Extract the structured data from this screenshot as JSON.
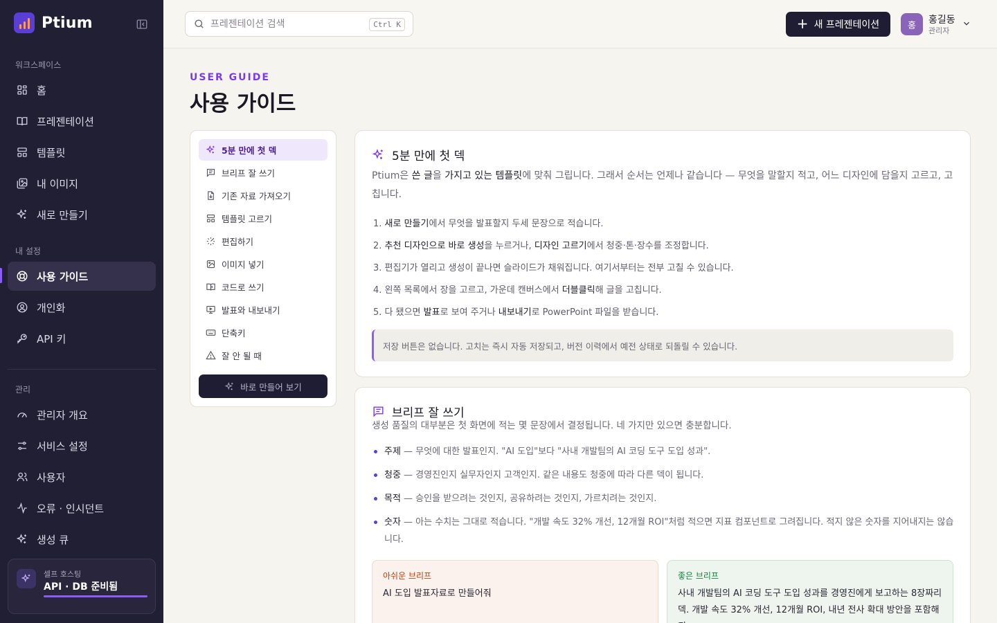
{
  "brand": {
    "name": "Ptium"
  },
  "sidebar": {
    "sections": {
      "workspace": "워크스페이스",
      "settings": "내 설정",
      "admin": "관리"
    },
    "items": [
      {
        "label": "홈",
        "icon": "grid-icon"
      },
      {
        "label": "프레젠테이션",
        "icon": "book-open-icon"
      },
      {
        "label": "템플릿",
        "icon": "layout-icon"
      },
      {
        "label": "내 이미지",
        "icon": "images-icon"
      },
      {
        "label": "새로 만들기",
        "icon": "sparkles-icon"
      },
      {
        "label": "사용 가이드",
        "icon": "lifebuoy-icon",
        "active": true
      },
      {
        "label": "개인화",
        "icon": "user-circle-icon"
      },
      {
        "label": "API 키",
        "icon": "key-icon"
      },
      {
        "label": "관리자 개요",
        "icon": "gauge-icon"
      },
      {
        "label": "서비스 설정",
        "icon": "sliders-icon"
      },
      {
        "label": "사용자",
        "icon": "users-icon"
      },
      {
        "label": "오류 · 인시던트",
        "icon": "activity-icon"
      },
      {
        "label": "생성 큐",
        "icon": "sparkles-icon"
      }
    ],
    "selfhost": {
      "label": "셀프 호스팅",
      "status": "API · DB 준비됨",
      "progress": 1.0
    }
  },
  "header": {
    "search_placeholder": "프레젠테이션 검색",
    "shortcut": "Ctrl K",
    "new_button": "새 프레젠테이션",
    "user": {
      "initial": "홍",
      "name": "홍길동",
      "role": "관리자"
    }
  },
  "page": {
    "eyebrow": "USER GUIDE",
    "title": "사용 가이드"
  },
  "toc": {
    "items": [
      {
        "label": "5분 만에 첫 덱",
        "icon": "sparkles-icon",
        "active": true
      },
      {
        "label": "브리프 잘 쓰기",
        "icon": "message-square-icon"
      },
      {
        "label": "기존 자료 가져오기",
        "icon": "file-import-icon"
      },
      {
        "label": "템플릿 고르기",
        "icon": "layout-icon"
      },
      {
        "label": "편집하기",
        "icon": "wand-icon"
      },
      {
        "label": "이미지 넣기",
        "icon": "image-icon"
      },
      {
        "label": "코드로 쓰기",
        "icon": "book-code-icon"
      },
      {
        "label": "발표와 내보내기",
        "icon": "presentation-icon"
      },
      {
        "label": "단축키",
        "icon": "keyboard-icon"
      },
      {
        "label": "잘 안 될 때",
        "icon": "alert-triangle-icon"
      }
    ],
    "cta": "바로 만들어 보기"
  },
  "quickstart": {
    "title": "5분 만에 첫 덱",
    "intro": {
      "p1": "Ptium은 ",
      "b1": "쓴 글",
      "p2": "을 ",
      "b2": "가지고 있는 템플릿",
      "p3": "에 맞춰 그립니다. 그래서 순서는 언제나 같습니다 — 무엇을 말할지 적고, 어느 디자인에 담을지 고르고, 고칩니다."
    },
    "steps": [
      {
        "n": "1.",
        "b1": "새로 만들기",
        "t1": "에서 무엇을 발표할지 두세 문장으로 적습니다.",
        "b2": "",
        "t2": "",
        "b3": "",
        "t3": ""
      },
      {
        "n": "2.",
        "b1": "추천 디자인으로 바로 생성",
        "t1": "을 누르거나, ",
        "b2": "디자인 고르기",
        "t2": "에서 청중·톤·장수를 조정합니다.",
        "b3": "",
        "t3": ""
      },
      {
        "n": "3.",
        "b1": "",
        "t1": "편집기가 열리고 생성이 끝나면 슬라이드가 채워집니다. 여기서부터는 전부 고칠 수 있습니다.",
        "b2": "",
        "t2": "",
        "b3": "",
        "t3": ""
      },
      {
        "n": "4.",
        "b1": "",
        "t1": "왼쪽 목록에서 장을 고르고, 가운데 캔버스에서 ",
        "b2": "더블클릭",
        "t2": "해 글을 고칩니다.",
        "b3": "",
        "t3": ""
      },
      {
        "n": "5.",
        "b1": "",
        "t1": "다 됐으면 ",
        "b2": "발표",
        "t2": "로 보여 주거나 ",
        "b3": "내보내기",
        "t3": "로 PowerPoint 파일을 받습니다."
      }
    ],
    "note": "저장 버튼은 없습니다. 고치는 즉시 자동 저장되고, 버전 이력에서 예전 상태로 되돌릴 수 있습니다."
  },
  "brief": {
    "title": "브리프 잘 쓰기",
    "intro": "생성 품질의 대부분은 첫 화면에 적는 몇 문장에서 결정됩니다. 네 가지만 있으면 충분합니다.",
    "bullets": [
      {
        "term": "주제",
        "text": " — 무엇에 대한 발표인지. \"AI 도입\"보다 \"사내 개발팀의 AI 코딩 도구 도입 성과\"."
      },
      {
        "term": "청중",
        "text": " — 경영진인지 실무자인지 고객인지. 같은 내용도 청중에 따라 다른 덱이 됩니다."
      },
      {
        "term": "목적",
        "text": " — 승인을 받으려는 것인지, 공유하려는 것인지, 가르치려는 것인지."
      },
      {
        "term": "숫자",
        "text": " — 아는 수치는 그대로 적습니다. \"개발 속도 32% 개선, 12개월 ROI\"처럼 적으면 지표 컴포넌트로 그려집니다. 적지 않은 숫자를 지어내지는 않습니다."
      }
    ],
    "bad": {
      "label": "아쉬운 브리프",
      "text": "AI 도입 발표자료로 만들어줘"
    },
    "good": {
      "label": "좋은 브리프",
      "text": "사내 개발팀의 AI 코딩 도구 도입 성과를 경영진에게 보고하는 8장짜리 덱. 개발 속도 32% 개선, 12개월 ROI, 내년 전사 확대 방안을 포함해줘."
    }
  },
  "colors": {
    "accent": "#7c3aed",
    "sidebar_bg": "#211f33",
    "primary_button": "#1f1d33"
  }
}
